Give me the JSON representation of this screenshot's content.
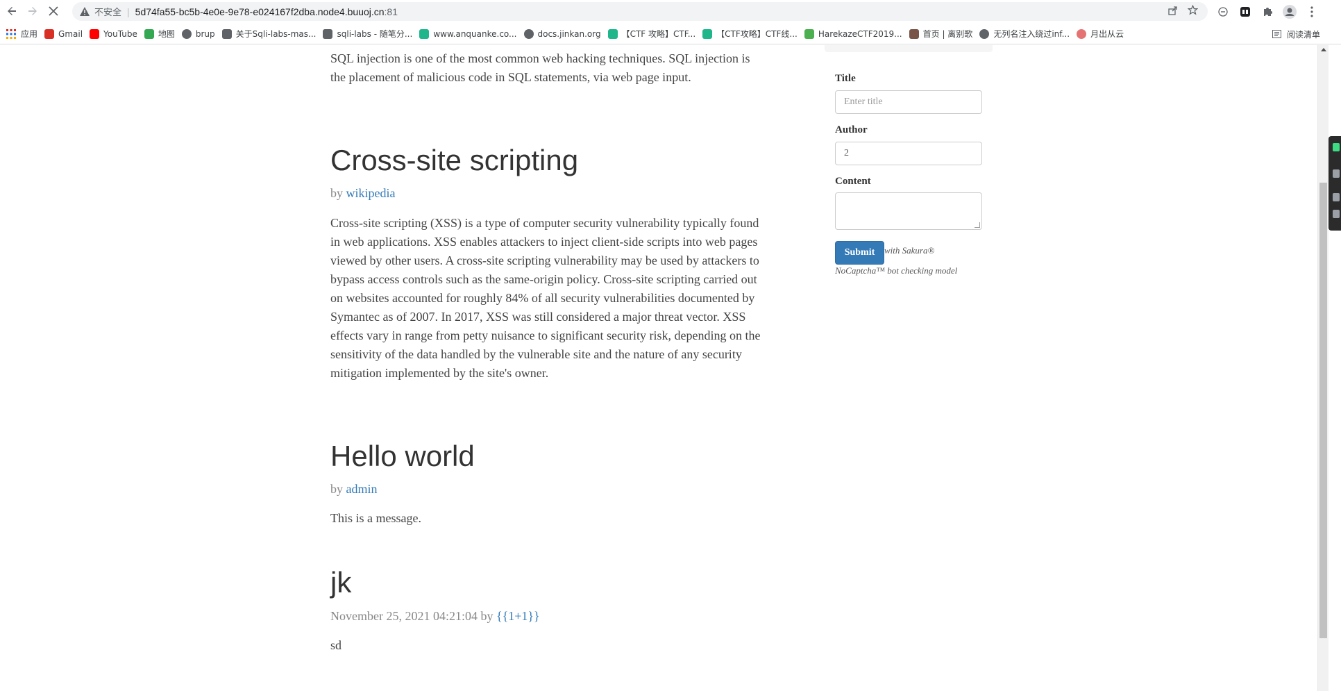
{
  "browser": {
    "back_icon": "arrow-left-icon",
    "forward_icon": "arrow-right-icon",
    "reload_icon": "stop-icon",
    "security_label": "不安全",
    "url_host": "5d74fa55-bc5b-4e0e-9e78-e024167f2dba.node4.buuoj.cn",
    "url_port": ":81",
    "omnibox_icons": [
      "share-icon",
      "star-icon"
    ],
    "extension_icons": [
      "minus-circle-icon",
      "extension-app-icon",
      "puzzle-icon",
      "profile-icon",
      "more-menu-icon"
    ]
  },
  "bookmarks": {
    "apps_label": "应用",
    "items": [
      {
        "label": "Gmail",
        "icon": "gmail-icon",
        "color": "#d93025"
      },
      {
        "label": "YouTube",
        "icon": "youtube-icon",
        "color": "#ff0000"
      },
      {
        "label": "地图",
        "icon": "maps-icon",
        "color": "#34a853"
      },
      {
        "label": "brup",
        "icon": "globe-icon",
        "color": "#5f6368"
      },
      {
        "label": "关于Sqli-labs-mas...",
        "icon": "sqli-icon",
        "color": "#5f6368"
      },
      {
        "label": "sqli-labs - 随笔分...",
        "icon": "sqli-icon",
        "color": "#5f6368"
      },
      {
        "label": "www.anquanke.co...",
        "icon": "anquanke-icon",
        "color": "#1fb68b"
      },
      {
        "label": "docs.jinkan.org",
        "icon": "globe-icon",
        "color": "#5f6368"
      },
      {
        "label": "【CTF 攻略】CTF...",
        "icon": "anquanke-icon",
        "color": "#1fb68b"
      },
      {
        "label": "【CTF攻略】CTF线...",
        "icon": "anquanke-icon",
        "color": "#1fb68b"
      },
      {
        "label": "HarekazeCTF2019...",
        "icon": "shield-icon",
        "color": "#4caf50"
      },
      {
        "label": "首页 | 离别歌",
        "icon": "leaf-icon",
        "color": "#795548"
      },
      {
        "label": "无列名注入绕过inf...",
        "icon": "globe-icon",
        "color": "#5f6368"
      },
      {
        "label": "月出从云",
        "icon": "avatar-icon",
        "color": "#e57373"
      }
    ],
    "reading_list_label": "阅读清单"
  },
  "posts": {
    "intro_text": "SQL injection is one of the most common web hacking techniques. SQL injection is the placement of malicious code in SQL statements, via web page input.",
    "xss": {
      "title": "Cross-site scripting",
      "by_label": "by",
      "author": "wikipedia",
      "body": "Cross-site scripting (XSS) is a type of computer security vulnerability typically found in web applications. XSS enables attackers to inject client-side scripts into web pages viewed by other users. A cross-site scripting vulnerability may be used by attackers to bypass access controls such as the same-origin policy. Cross-site scripting carried out on websites accounted for roughly 84% of all security vulnerabilities documented by Symantec as of 2007. In 2017, XSS was still considered a major threat vector. XSS effects vary in range from petty nuisance to significant security risk, depending on the sensitivity of the data handled by the vulnerable site and the nature of any security mitigation implemented by the site's owner."
    },
    "hello": {
      "title": "Hello world",
      "by_label": "by",
      "author": "admin",
      "body": "This is a message."
    },
    "jk": {
      "title": "jk",
      "date": "November 25, 2021 04:21:04",
      "by_label": "by",
      "author": "{{1+1}}",
      "body": "sd"
    }
  },
  "form": {
    "title_label": "Title",
    "title_placeholder": "Enter title",
    "author_label": "Author",
    "author_value": "2",
    "content_label": "Content",
    "submit_label": "Submit",
    "captcha_line1": "with Sakura®",
    "captcha_line2": "NoCaptcha™ bot checking model"
  }
}
